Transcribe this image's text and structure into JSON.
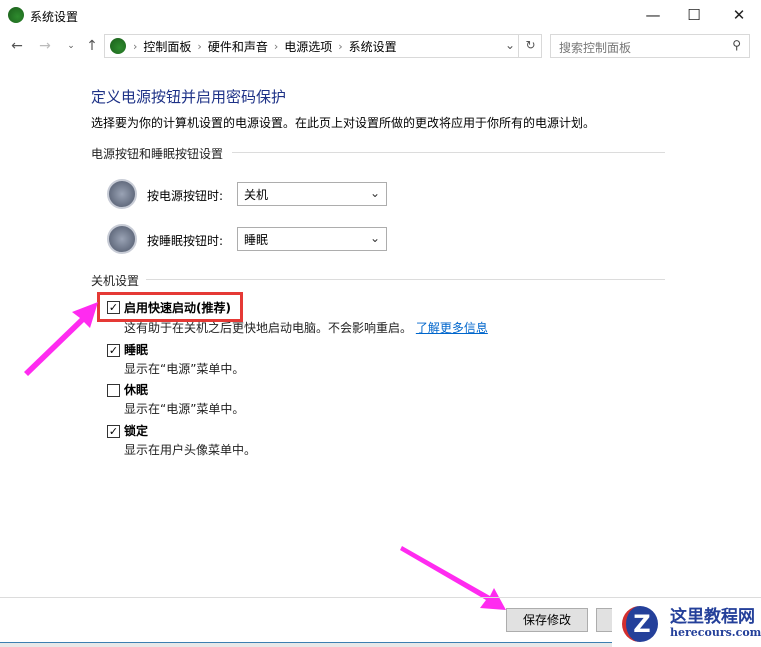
{
  "window": {
    "title": "系统设置"
  },
  "breadcrumb": [
    "控制面板",
    "硬件和声音",
    "电源选项",
    "系统设置"
  ],
  "search": {
    "placeholder": "搜索控制面板"
  },
  "page": {
    "heading": "定义电源按钮并启用密码保护",
    "description": "选择要为你的计算机设置的电源设置。在此页上对设置所做的更改将应用于你所有的电源计划。"
  },
  "power_section": {
    "title": "电源按钮和睡眠按钮设置",
    "power_button": {
      "label": "按电源按钮时:",
      "value": "关机"
    },
    "sleep_button": {
      "label": "按睡眠按钮时:",
      "value": "睡眠"
    }
  },
  "shutdown_section": {
    "title": "关机设置",
    "items": [
      {
        "label": "启用快速启动(推荐)",
        "checked": true,
        "sub": "这有助于在关机之后更快地启动电脑。不会影响重启。",
        "link": "了解更多信息"
      },
      {
        "label": "睡眠",
        "checked": true,
        "sub": "显示在“电源”菜单中。"
      },
      {
        "label": "休眠",
        "checked": false,
        "sub": "显示在“电源”菜单中。"
      },
      {
        "label": "锁定",
        "checked": true,
        "sub": "显示在用户头像菜单中。"
      }
    ]
  },
  "footer": {
    "save": "保存修改"
  },
  "watermark": {
    "name": "这里教程网",
    "url": "herecours.com"
  },
  "colors": {
    "heading": "#1e3287",
    "highlight": "#e53935",
    "arrow": "#ff2bf0",
    "link": "#0066cc"
  }
}
